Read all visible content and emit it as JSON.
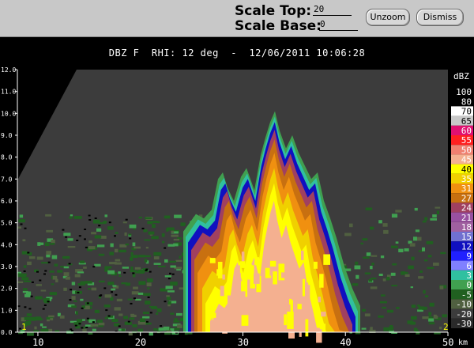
{
  "toolbar": {
    "scale_top_label": "Scale Top:",
    "scale_top_value": "20",
    "scale_base_label": "Scale Base:",
    "scale_base_value": "0",
    "unzoom_label": "Unzoom",
    "dismiss_label": "Dismiss"
  },
  "plot": {
    "title": "DBZ F  RHI: 12 deg  -  12/06/2011 10:06:28",
    "background_color": "#3c3c3c",
    "x_axis": {
      "unit": "km",
      "range": [
        8,
        50
      ],
      "ticks": [
        {
          "value": 10,
          "label": "10"
        },
        {
          "value": 20,
          "label": "20"
        },
        {
          "value": 30,
          "label": "30"
        },
        {
          "value": 40,
          "label": "40"
        },
        {
          "value": 50,
          "label": "50"
        }
      ]
    },
    "y_axis": {
      "range": [
        0,
        12
      ],
      "ticks": [
        "0.0",
        "1.0",
        "2.0",
        "3.0",
        "4.0",
        "5.0",
        "6.0",
        "7.0",
        "8.0",
        "9.0",
        "10.0",
        "11.0",
        "12.0"
      ]
    },
    "corner_markers": [
      {
        "label": "1",
        "color": "#ffff00",
        "side": "left"
      },
      {
        "label": "2",
        "color": "#ffff00",
        "side": "right"
      }
    ]
  },
  "legend": {
    "unit": "dBZ",
    "levels": [
      {
        "label": "100",
        "color": "#000000"
      },
      {
        "label": "80",
        "color": "#000000"
      },
      {
        "label": "70",
        "color": "#ffffff"
      },
      {
        "label": "65",
        "color": "#c8c8c8"
      },
      {
        "label": "60",
        "color": "#e01070"
      },
      {
        "label": "55",
        "color": "#ff2020"
      },
      {
        "label": "50",
        "color": "#f08070"
      },
      {
        "label": "45",
        "color": "#f4b090"
      },
      {
        "label": "40",
        "color": "#ffff00"
      },
      {
        "label": "35",
        "color": "#f0d000"
      },
      {
        "label": "31",
        "color": "#f09010"
      },
      {
        "label": "27",
        "color": "#c87010"
      },
      {
        "label": "24",
        "color": "#a04060"
      },
      {
        "label": "21",
        "color": "#9850a0"
      },
      {
        "label": "18",
        "color": "#a060a0"
      },
      {
        "label": "15",
        "color": "#7070d0"
      },
      {
        "label": "12",
        "color": "#1010c0"
      },
      {
        "label": "9",
        "color": "#2020ff"
      },
      {
        "label": "6",
        "color": "#8080ff"
      },
      {
        "label": "3",
        "color": "#30c0a0"
      },
      {
        "label": "0",
        "color": "#40a050"
      },
      {
        "label": "-5",
        "color": "#206020"
      },
      {
        "label": "-10",
        "color": "#506040"
      },
      {
        "label": "-20",
        "color": "#3c3c3c"
      },
      {
        "label": "-30",
        "color": "#2a2a2a"
      }
    ]
  }
}
